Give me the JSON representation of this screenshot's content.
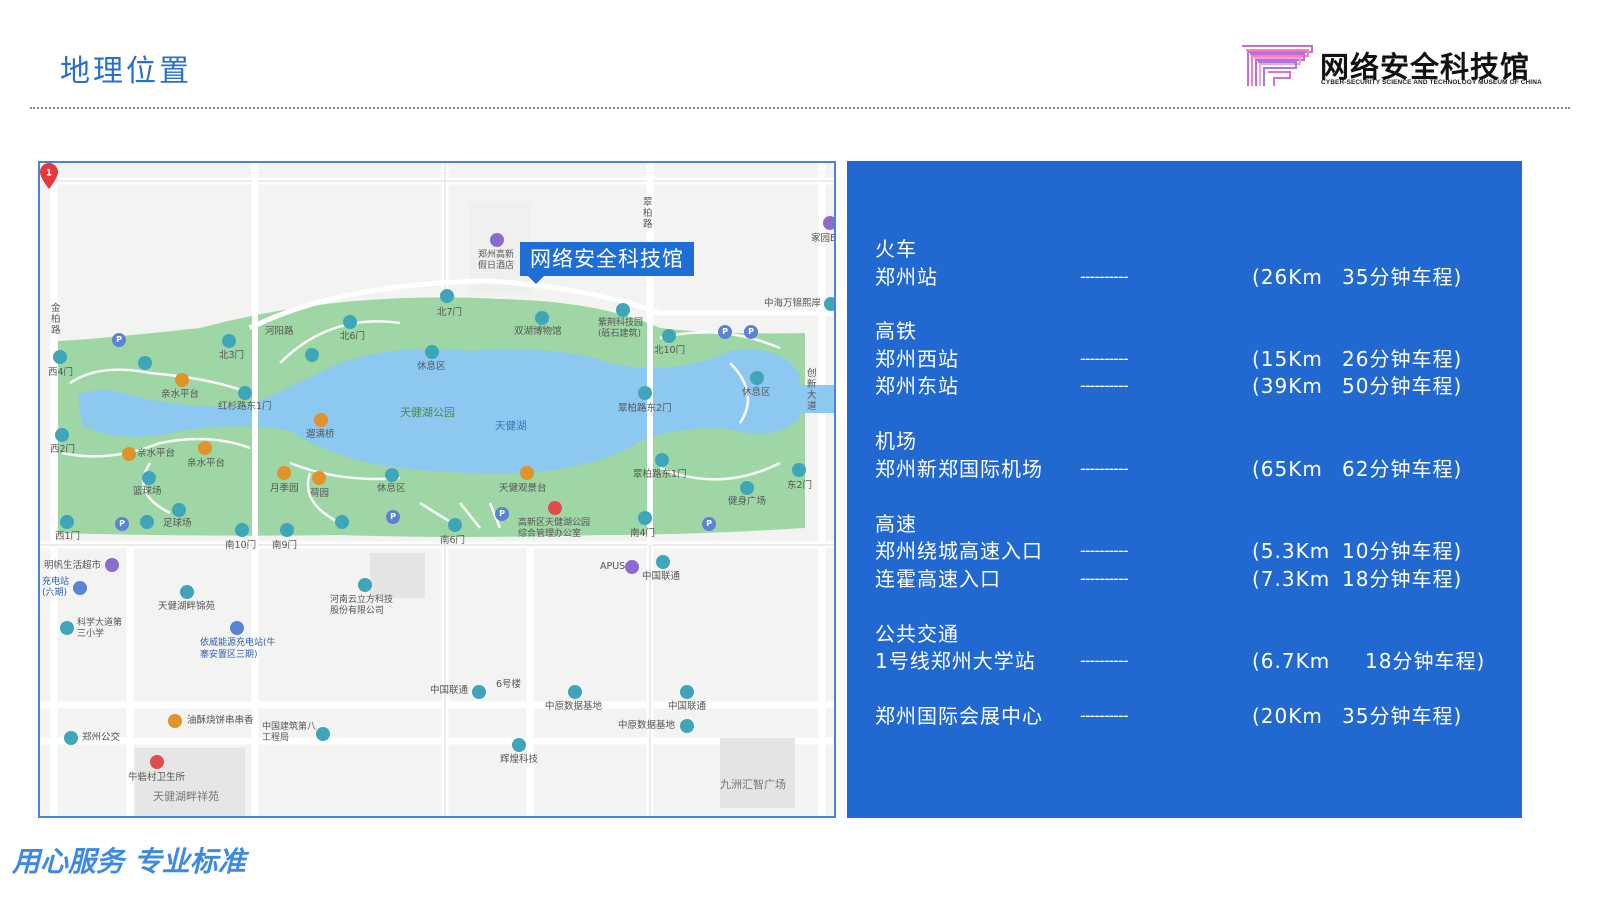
{
  "header": {
    "title": "地理位置",
    "logo": {
      "name_cn": "网络安全科技馆",
      "name_en": "CYBER-SECURITY SCIENCE AND TECHNOLOGY MUSEUM OF CHINA"
    }
  },
  "map": {
    "callout_label": "网络安全科技馆",
    "pin_number": "1",
    "labels": {
      "park": "天健湖公园",
      "lake": "天健湖",
      "rest1": "休息区",
      "rest2": "休息区",
      "rest3": "休息区",
      "hotel": "郑州高新假日酒店",
      "museum": "双湖博物馆",
      "zijing": "紫荆科技园(砥石建筑)",
      "cuibai_road": "翠柏路",
      "jinbai_road": "金柏路",
      "hexiang_road": "河阳路",
      "chuangxin_ave": "创新大道",
      "home": "家园E",
      "zhonghai": "中海万锦熙岸",
      "north7": "北7门",
      "north6": "北6门",
      "north3": "北3门",
      "north10": "北10门",
      "west4": "西4门",
      "west2": "西2门",
      "west1": "西1门",
      "east2": "东2门",
      "south10": "南10门",
      "south9": "南9门",
      "south6": "南6门",
      "south4": "南4门",
      "cuibai_east2": "翠柏路东2门",
      "cuibai_east1": "翠柏路东1门",
      "hongshan": "红杉路东1门",
      "yingshui": "亲水平台",
      "yingshui2": "亲水平台",
      "yingshui3": "亲水平台",
      "basketball": "篮球场",
      "football": "足球场",
      "yueji": "月季园",
      "hepu": "荷园",
      "bridge": "遛满桥",
      "fitness": "健身广场",
      "tianjian_observe": "天健观景台",
      "office": "高新区天健湖公园综合管理办公室",
      "mingfan": "明帆生活超市",
      "charging": "充电站(六期)",
      "tianjian_garden": "天健湖畔锦苑",
      "kexue": "科学大道第三小学",
      "yiwei": "依威能源充电站(牛寨安置区三期)",
      "henan_cloud": "河南云立方科技股份有限公司",
      "apus": "APUS",
      "unicom1": "中国联通",
      "unicom2": "中国联通",
      "unicom3": "中国联通",
      "building6": "6号楼",
      "zhongyuan1": "中原数据基地",
      "zhongyuan2": "中原数据基地",
      "youtiao": "油酥烧饼串串香",
      "cscec": "中国建筑第八工程局",
      "zhengzhou_bus": "郑州公交",
      "niuzhai": "牛砦村卫生所",
      "tianjian_xiangyuan": "天健湖畔祥苑",
      "huiyao": "辉煌科技",
      "jiuzhou": "九洲汇智广场"
    }
  },
  "transport": {
    "dash_text": "----------",
    "groups": [
      {
        "category": "火车",
        "items": [
          {
            "name": "郑州站",
            "distance": "(26Km",
            "time": "35分钟车程)"
          }
        ]
      },
      {
        "category": "高铁",
        "items": [
          {
            "name": "郑州西站",
            "distance": "(15Km",
            "time": "26分钟车程)"
          },
          {
            "name": "郑州东站",
            "distance": "(39Km",
            "time": "50分钟车程)"
          }
        ]
      },
      {
        "category": "机场",
        "items": [
          {
            "name": "郑州新郑国际机场",
            "distance": "(65Km",
            "time": "62分钟车程)"
          }
        ]
      },
      {
        "category": "高速",
        "items": [
          {
            "name": "郑州绕城高速入口",
            "distance": "(5.3Km",
            "time": "10分钟车程)"
          },
          {
            "name": "连霍高速入口",
            "distance": "(7.3Km",
            "time": "18分钟车程)"
          }
        ]
      },
      {
        "category": "公共交通",
        "items": [
          {
            "name": "1号线郑州大学站",
            "distance": "(6.7Km",
            "time": "18分钟车程)"
          }
        ]
      },
      {
        "category": "",
        "items": [
          {
            "name": "郑州国际会展中心",
            "distance": "(20Km",
            "time": "35分钟车程)"
          }
        ]
      }
    ]
  },
  "footer": {
    "slogan": "用心服务 专业标准"
  }
}
